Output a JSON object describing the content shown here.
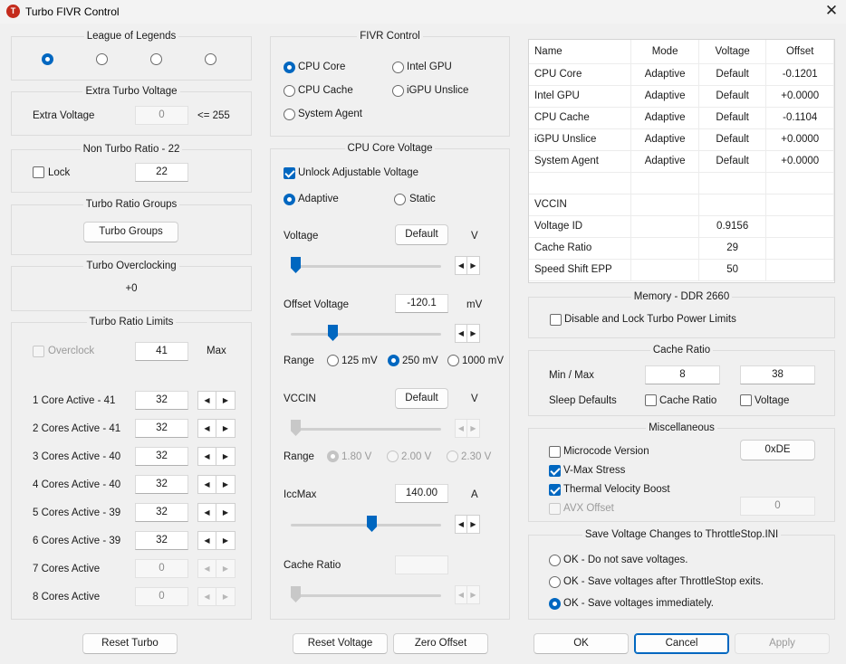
{
  "window": {
    "title": "Turbo FIVR Control",
    "close_glyph": "✕"
  },
  "groups": {
    "league": "League of Legends",
    "extra_turbo": "Extra Turbo Voltage",
    "non_turbo": "Non Turbo Ratio - 22",
    "turbo_groups": "Turbo Ratio Groups",
    "turbo_oc": "Turbo Overclocking",
    "turbo_limits": "Turbo Ratio Limits",
    "fivr": "FIVR Control",
    "cpu_core_voltage": "CPU Core Voltage",
    "memory": "Memory - DDR 2660",
    "cache_ratio": "Cache Ratio",
    "misc": "Miscellaneous",
    "save": "Save Voltage Changes to ThrottleStop.INI"
  },
  "extra_turbo": {
    "label": "Extra Voltage",
    "value": "0",
    "limit": "<= 255"
  },
  "non_turbo": {
    "lock_label": "Lock",
    "value": "22"
  },
  "turbo_groups_button": "Turbo Groups",
  "turbo_oc_value": "+0",
  "turbo_limits": {
    "overclock_label": "Overclock",
    "overclock_value": "41",
    "max_label": "Max",
    "rows": [
      {
        "label": "1 Core  Active - 41",
        "value": "32"
      },
      {
        "label": "2 Cores Active - 41",
        "value": "32"
      },
      {
        "label": "3 Cores Active - 40",
        "value": "32"
      },
      {
        "label": "4 Cores Active - 40",
        "value": "32"
      },
      {
        "label": "5 Cores Active - 39",
        "value": "32"
      },
      {
        "label": "6 Cores Active - 39",
        "value": "32"
      },
      {
        "label": "7 Cores Active",
        "value": "0"
      },
      {
        "label": "8 Cores Active",
        "value": "0"
      }
    ]
  },
  "fivr": {
    "cpu_core": "CPU Core",
    "intel_gpu": "Intel GPU",
    "cpu_cache": "CPU Cache",
    "igpu_unslice": "iGPU Unslice",
    "system_agent": "System Agent"
  },
  "voltage": {
    "unlock_label": "Unlock Adjustable Voltage",
    "adaptive": "Adaptive",
    "static": "Static",
    "voltage_label": "Voltage",
    "voltage_btn": "Default",
    "voltage_unit": "V",
    "offset_label": "Offset Voltage",
    "offset_value": "-120.1",
    "offset_unit": "mV",
    "range_label": "Range",
    "r125": "125 mV",
    "r250": "250 mV",
    "r1000": "1000 mV",
    "vccin_label": "VCCIN",
    "vccin_btn": "Default",
    "vccin_unit": "V",
    "range2_label": "Range",
    "v180": "1.80 V",
    "v200": "2.00 V",
    "v230": "2.30 V",
    "iccmax_label": "IccMax",
    "iccmax_value": "140.00",
    "iccmax_unit": "A",
    "cache_ratio_label": "Cache Ratio",
    "cache_ratio_value": ""
  },
  "table": {
    "headers": [
      "Name",
      "Mode",
      "Voltage",
      "Offset"
    ],
    "rows": [
      [
        "CPU Core",
        "Adaptive",
        "Default",
        "-0.1201"
      ],
      [
        "Intel GPU",
        "Adaptive",
        "Default",
        "+0.0000"
      ],
      [
        "CPU Cache",
        "Adaptive",
        "Default",
        "-0.1104"
      ],
      [
        "iGPU Unslice",
        "Adaptive",
        "Default",
        "+0.0000"
      ],
      [
        "System Agent",
        "Adaptive",
        "Default",
        "+0.0000"
      ],
      [
        "",
        "",
        "",
        ""
      ],
      [
        "VCCIN",
        "",
        "",
        ""
      ],
      [
        "Voltage ID",
        "",
        "0.9156",
        ""
      ],
      [
        "Cache Ratio",
        "",
        "29",
        ""
      ],
      [
        "Speed Shift EPP",
        "",
        "50",
        ""
      ]
    ]
  },
  "memory": {
    "disable_label": "Disable and Lock Turbo Power Limits"
  },
  "cache_ratio": {
    "minmax_label": "Min / Max",
    "min": "8",
    "max": "38",
    "sleep_label": "Sleep Defaults",
    "cache_chk": "Cache Ratio",
    "voltage_chk": "Voltage"
  },
  "misc": {
    "microcode": "Microcode Version",
    "microcode_value": "0xDE",
    "vmax": "V-Max Stress",
    "tvb": "Thermal Velocity Boost",
    "avx": "AVX Offset",
    "avx_value": "0"
  },
  "save": {
    "opt1": "OK - Do not save voltages.",
    "opt2": "OK - Save voltages after ThrottleStop exits.",
    "opt3": "OK - Save voltages immediately."
  },
  "buttons": {
    "reset_turbo": "Reset Turbo",
    "reset_voltage": "Reset Voltage",
    "zero_offset": "Zero Offset",
    "ok": "OK",
    "cancel": "Cancel",
    "apply": "Apply"
  },
  "spin": {
    "left": "◀",
    "right": "▶"
  }
}
